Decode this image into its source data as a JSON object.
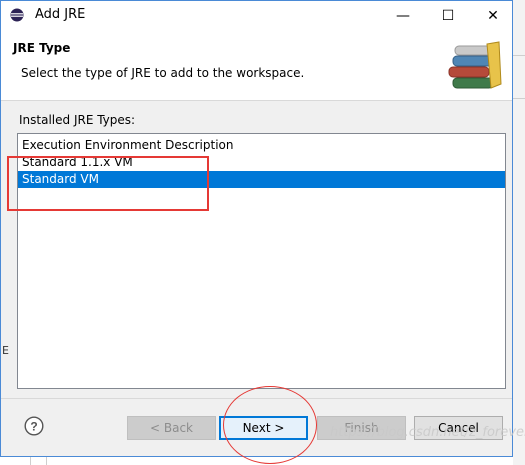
{
  "window": {
    "title": "Add JRE",
    "minimize": "—",
    "maximize": "☐",
    "close": "✕"
  },
  "header": {
    "title": "JRE Type",
    "description": "Select the type of JRE to add to the workspace."
  },
  "installed_label": "Installed JRE Types:",
  "jre_types": [
    {
      "label": "Execution Environment Description",
      "selected": false
    },
    {
      "label": "Standard 1.1.x VM",
      "selected": false
    },
    {
      "label": "Standard VM",
      "selected": true
    }
  ],
  "buttons": {
    "back": "< Back",
    "next": "Next >",
    "finish": "Finish",
    "cancel": "Cancel"
  },
  "help_symbol": "?",
  "watermark": "https://blog.csdn.net/z_forevers",
  "background_fragment": "E",
  "colors": {
    "selection": "#0078d7",
    "annotation": "#e53935",
    "window_border": "#4a8ad6"
  }
}
